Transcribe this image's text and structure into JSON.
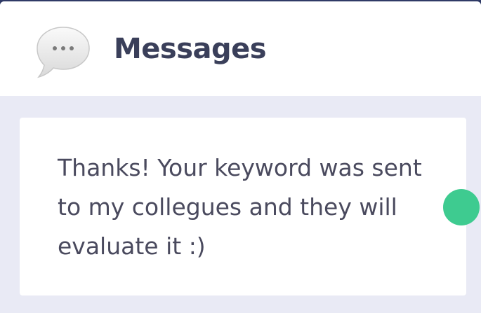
{
  "header": {
    "title": "Messages",
    "icon": "speech-bubble-icon"
  },
  "message": {
    "text": "Thanks! Your keyword was sent to my collegues and they will evaluate it :)"
  },
  "status": {
    "online_color": "#3ecb90"
  },
  "colors": {
    "panel_background": "#e9eaf5",
    "header_background": "#ffffff",
    "title_color": "#3a3f5a",
    "message_text_color": "#4a4a5e"
  }
}
